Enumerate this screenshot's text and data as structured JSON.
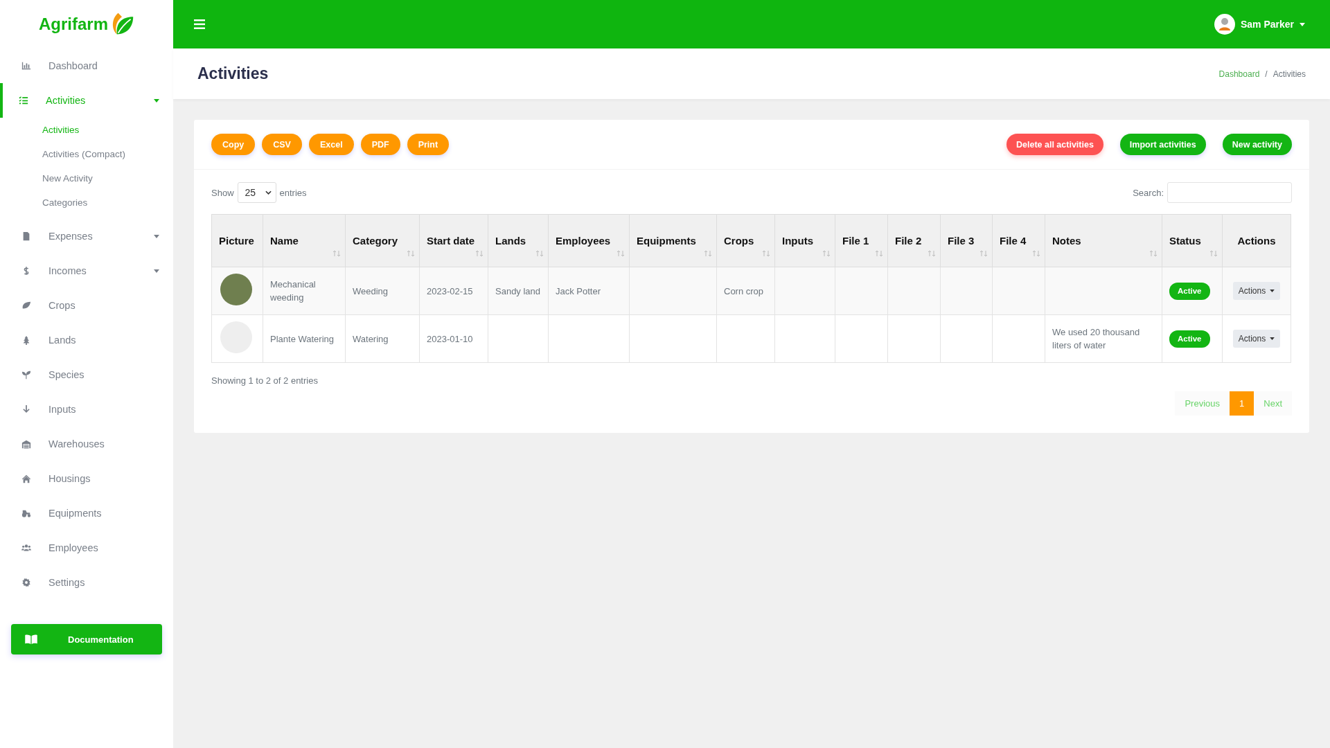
{
  "brand": {
    "name": "Agrifarm"
  },
  "sidebar": {
    "items": [
      {
        "label": "Dashboard",
        "selected": false
      },
      {
        "label": "Activities",
        "selected": true,
        "expanded": true,
        "children": [
          {
            "label": "Activities",
            "selected": true
          },
          {
            "label": "Activities (Compact)",
            "selected": false
          },
          {
            "label": "New Activity",
            "selected": false
          },
          {
            "label": "Categories",
            "selected": false
          }
        ]
      },
      {
        "label": "Expenses",
        "selected": false,
        "expanded": false
      },
      {
        "label": "Incomes",
        "selected": false,
        "expanded": false
      },
      {
        "label": "Crops",
        "selected": false
      },
      {
        "label": "Lands",
        "selected": false
      },
      {
        "label": "Species",
        "selected": false
      },
      {
        "label": "Inputs",
        "selected": false
      },
      {
        "label": "Warehouses",
        "selected": false
      },
      {
        "label": "Housings",
        "selected": false
      },
      {
        "label": "Equipments",
        "selected": false
      },
      {
        "label": "Employees",
        "selected": false
      },
      {
        "label": "Settings",
        "selected": false
      }
    ],
    "documentation_button": "Documentation"
  },
  "topbar": {
    "user": "Sam Parker"
  },
  "page": {
    "title": "Activities",
    "breadcrumb_separator": "/",
    "breadcrumb": [
      {
        "label": "Dashboard",
        "kind": "link"
      },
      {
        "label": "Activities",
        "kind": "current"
      }
    ]
  },
  "toolbar": {
    "export_buttons": [
      "Copy",
      "CSV",
      "Excel",
      "PDF",
      "Print"
    ],
    "actions": [
      {
        "label": "Delete all activities",
        "kind": "danger"
      },
      {
        "label": "Import activities",
        "kind": "primary"
      },
      {
        "label": "New activity",
        "kind": "primary"
      }
    ]
  },
  "length": {
    "before": "Show",
    "value": "25",
    "after": "entries"
  },
  "search": {
    "label": "Search:"
  },
  "table": {
    "columns": [
      {
        "label": "Picture",
        "sortable": false
      },
      {
        "label": "Name",
        "sortable": true
      },
      {
        "label": "Category",
        "sortable": true
      },
      {
        "label": "Start date",
        "sortable": true
      },
      {
        "label": "Lands",
        "sortable": true
      },
      {
        "label": "Employees",
        "sortable": true
      },
      {
        "label": "Equipments",
        "sortable": true
      },
      {
        "label": "Crops",
        "sortable": true
      },
      {
        "label": "Inputs",
        "sortable": true
      },
      {
        "label": "File 1",
        "sortable": true
      },
      {
        "label": "File 2",
        "sortable": true
      },
      {
        "label": "File 3",
        "sortable": true
      },
      {
        "label": "File 4",
        "sortable": true
      },
      {
        "label": "Notes",
        "sortable": true
      },
      {
        "label": "Status",
        "sortable": true
      },
      {
        "label": "Actions",
        "sortable": false
      }
    ],
    "rows": [
      {
        "has_photo": true,
        "cells": [
          "",
          "Mechanical weeding",
          "Weeding",
          "2023-02-15",
          "Sandy land",
          "Jack Potter",
          "",
          "Corn crop",
          "",
          "",
          "",
          "",
          "",
          "",
          "Active",
          "Actions"
        ]
      },
      {
        "has_photo": false,
        "cells": [
          "",
          "Plante Watering",
          "Watering",
          "2023-01-10",
          "",
          "",
          "",
          "",
          "",
          "",
          "",
          "",
          "",
          "We used 20 thousand liters of water",
          "Active",
          "Actions"
        ]
      }
    ]
  },
  "info": "Showing 1 to 2 of 2 entries",
  "pagination": {
    "previous": "Previous",
    "pages": [
      {
        "label": "1",
        "selected": true
      }
    ],
    "next": "Next"
  }
}
